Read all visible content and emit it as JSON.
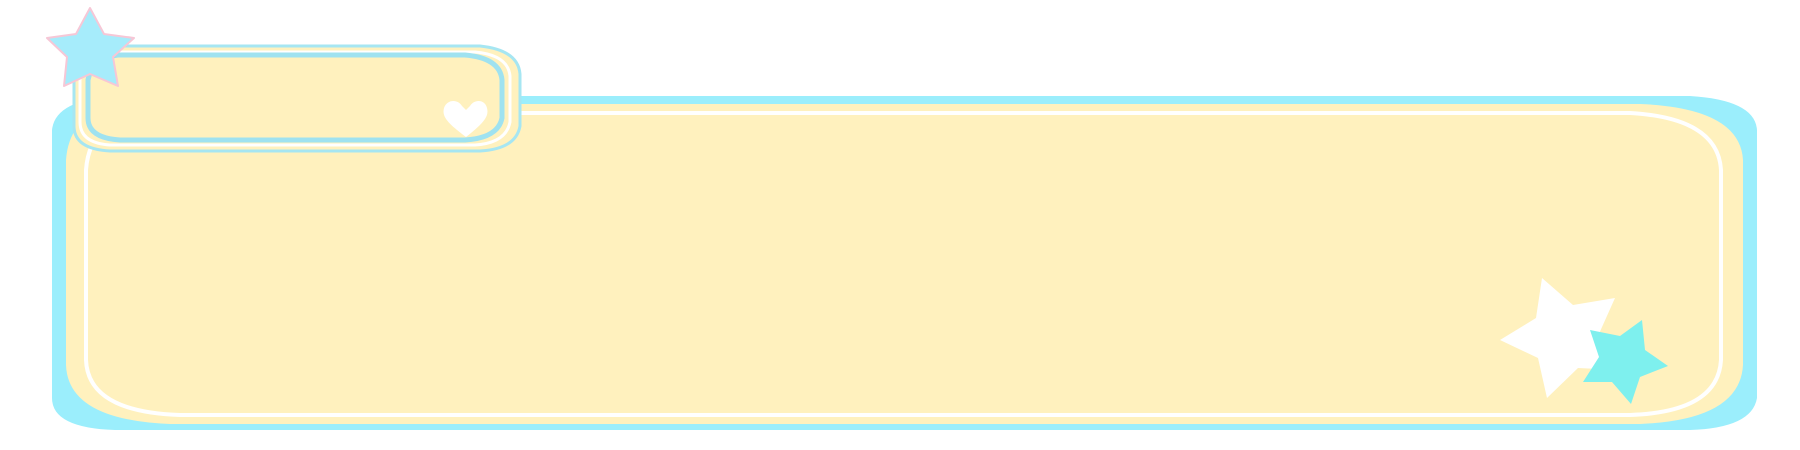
{
  "banner": {
    "colors": {
      "outer_border": "#9beefc",
      "panel_fill": "#fff1be",
      "inner_line": "#ffffff",
      "tab_border": "#a6e6f2",
      "star_blue": "#a6ecfb",
      "star_teal": "#7ef0ee",
      "star_white": "#ffffff",
      "heart": "#ffffff"
    },
    "decorations": [
      "star-icon",
      "heart-icon",
      "star-icon",
      "star-icon"
    ]
  }
}
